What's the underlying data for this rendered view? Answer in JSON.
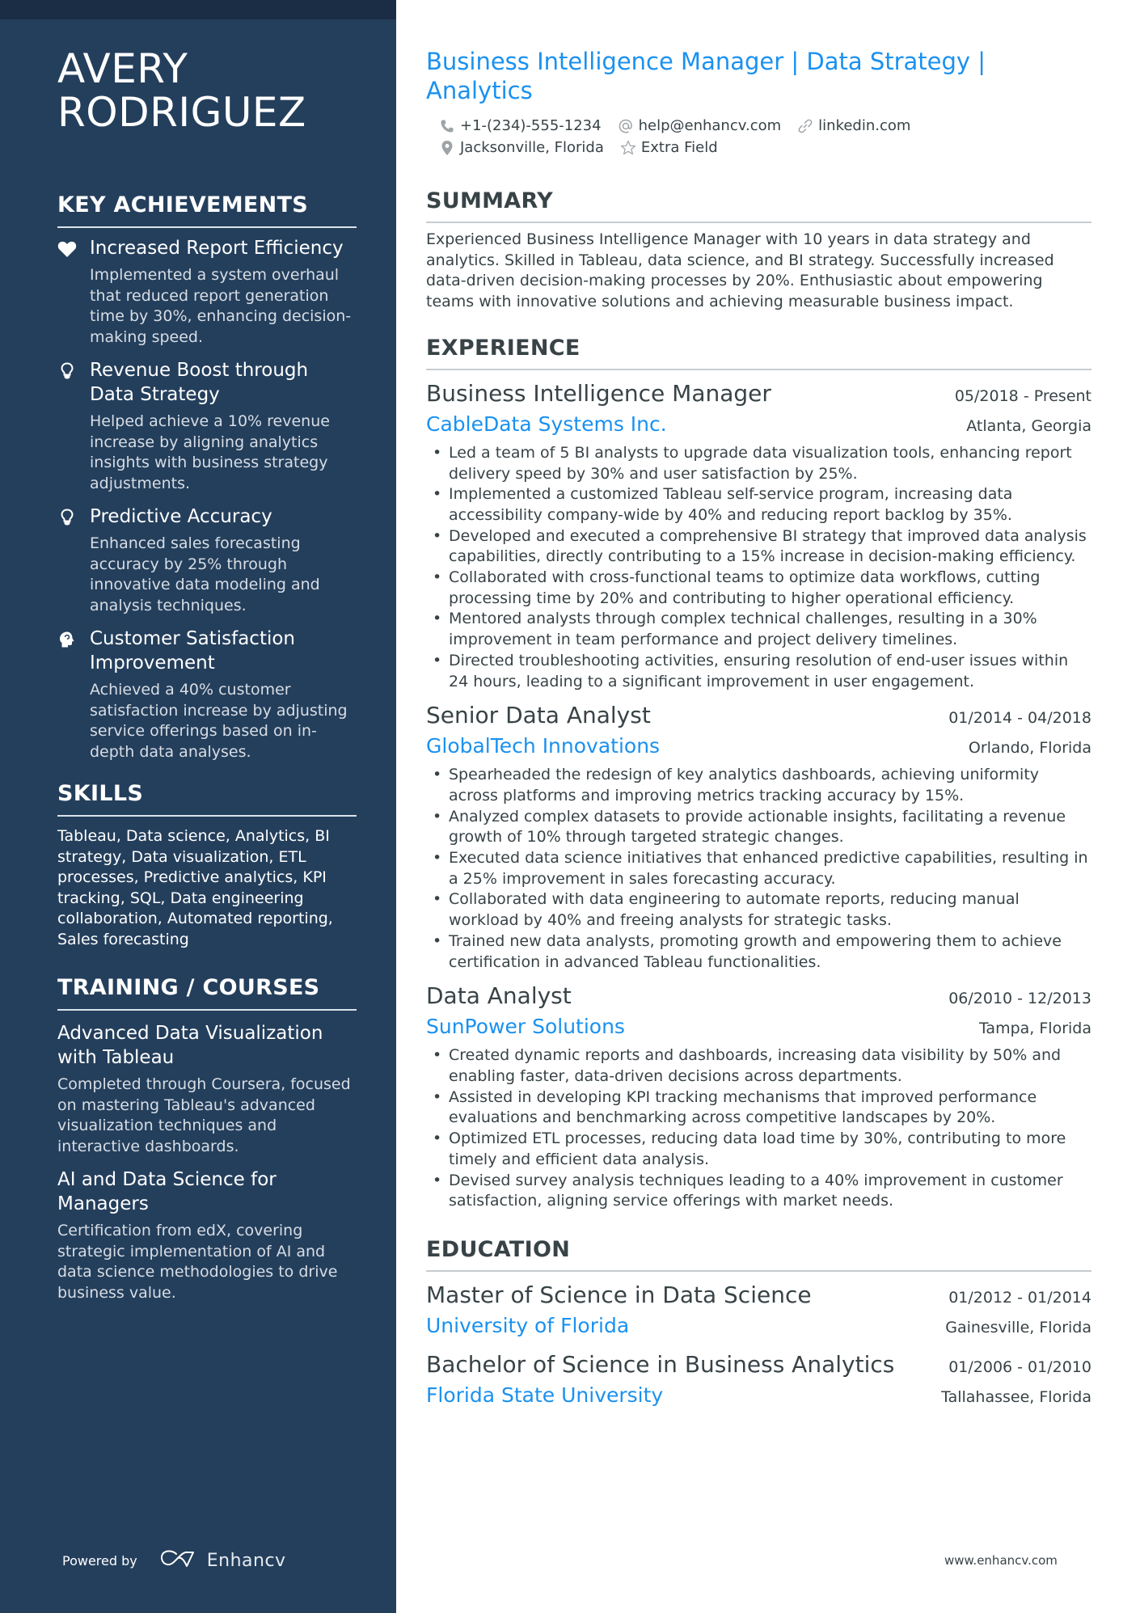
{
  "sidebar": {
    "name_line1": "AVERY",
    "name_line2": "RODRIGUEZ",
    "achievements_heading": "KEY ACHIEVEMENTS",
    "achievements": [
      {
        "icon": "heart-icon",
        "title": "Increased Report Efficiency",
        "description": "Implemented a system overhaul that reduced report generation time by 30%, enhancing decision-making speed."
      },
      {
        "icon": "lightbulb-icon",
        "title": "Revenue Boost through Data Strategy",
        "description": "Helped achieve a 10% revenue increase by aligning analytics insights with business strategy adjustments."
      },
      {
        "icon": "lightbulb-icon",
        "title": "Predictive Accuracy",
        "description": "Enhanced sales forecasting accuracy by 25% through innovative data modeling and analysis techniques."
      },
      {
        "icon": "head-brain-icon",
        "title": "Customer Satisfaction Improvement",
        "description": "Achieved a 40% customer satisfaction increase by adjusting service offerings based on in-depth data analyses."
      }
    ],
    "skills_heading": "SKILLS",
    "skills_text": "Tableau, Data science, Analytics, BI strategy, Data visualization, ETL processes, Predictive analytics, KPI tracking, SQL, Data engineering collaboration, Automated reporting, Sales forecasting",
    "training_heading": "TRAINING / COURSES",
    "courses": [
      {
        "title": "Advanced Data Visualization with Tableau",
        "description": "Completed through Coursera, focused on mastering Tableau's advanced visualization techniques and interactive dashboards."
      },
      {
        "title": "AI and Data Science for Managers",
        "description": "Certification from edX, covering strategic implementation of AI and data science methodologies to drive business value."
      }
    ],
    "powered_by": "Powered by",
    "brand": "Enhancv"
  },
  "header": {
    "title": "Business Intelligence Manager | Data Strategy | Analytics",
    "phone": "+1-(234)-555-1234",
    "email": "help@enhancv.com",
    "linkedin": "linkedin.com",
    "location": "Jacksonville, Florida",
    "extra": "Extra Field"
  },
  "summary": {
    "heading": "SUMMARY",
    "text": "Experienced Business Intelligence Manager with 10 years in data strategy and analytics. Skilled in Tableau, data science, and BI strategy. Successfully increased data-driven decision-making processes by 20%. Enthusiastic about empowering teams with innovative solutions and achieving measurable business impact."
  },
  "experience": {
    "heading": "EXPERIENCE",
    "jobs": [
      {
        "title": "Business Intelligence Manager",
        "dates": "05/2018 - Present",
        "company": "CableData Systems Inc.",
        "location": "Atlanta, Georgia",
        "bullets": [
          "Led a team of 5 BI analysts to upgrade data visualization tools, enhancing report delivery speed by 30% and user satisfaction by 25%.",
          "Implemented a customized Tableau self-service program, increasing data accessibility company-wide by 40% and reducing report backlog by 35%.",
          "Developed and executed a comprehensive BI strategy that improved data analysis capabilities, directly contributing to a 15% increase in decision-making efficiency.",
          "Collaborated with cross-functional teams to optimize data workflows, cutting processing time by 20% and contributing to higher operational efficiency.",
          "Mentored analysts through complex technical challenges, resulting in a 30% improvement in team performance and project delivery timelines.",
          "Directed troubleshooting activities, ensuring resolution of end-user issues within 24 hours, leading to a significant improvement in user engagement."
        ]
      },
      {
        "title": "Senior Data Analyst",
        "dates": "01/2014 - 04/2018",
        "company": "GlobalTech Innovations",
        "location": "Orlando, Florida",
        "bullets": [
          "Spearheaded the redesign of key analytics dashboards, achieving uniformity across platforms and improving metrics tracking accuracy by 15%.",
          "Analyzed complex datasets to provide actionable insights, facilitating a revenue growth of 10% through targeted strategic changes.",
          "Executed data science initiatives that enhanced predictive capabilities, resulting in a 25% improvement in sales forecasting accuracy.",
          "Collaborated with data engineering to automate reports, reducing manual workload by 40% and freeing analysts for strategic tasks.",
          "Trained new data analysts, promoting growth and empowering them to achieve certification in advanced Tableau functionalities."
        ]
      },
      {
        "title": "Data Analyst",
        "dates": "06/2010 - 12/2013",
        "company": "SunPower Solutions",
        "location": "Tampa, Florida",
        "bullets": [
          "Created dynamic reports and dashboards, increasing data visibility by 50% and enabling faster, data-driven decisions across departments.",
          "Assisted in developing KPI tracking mechanisms that improved performance evaluations and benchmarking across competitive landscapes by 20%.",
          "Optimized ETL processes, reducing data load time by 30%, contributing to more timely and efficient data analysis.",
          "Devised survey analysis techniques leading to a 40% improvement in customer satisfaction, aligning service offerings with market needs."
        ]
      }
    ]
  },
  "education": {
    "heading": "EDUCATION",
    "items": [
      {
        "degree": "Master of Science in Data Science",
        "dates": "01/2012 - 01/2014",
        "school": "University of Florida",
        "location": "Gainesville, Florida"
      },
      {
        "degree": "Bachelor of Science in Business Analytics",
        "dates": "01/2006 - 01/2010",
        "school": "Florida State University",
        "location": "Tallahassee, Florida"
      }
    ]
  },
  "footer": {
    "url": "www.enhancv.com"
  },
  "colors": {
    "sidebar": "#243f5c",
    "sidebar_top": "#1b2d45",
    "accent": "#1a91f0",
    "text": "#384347"
  }
}
